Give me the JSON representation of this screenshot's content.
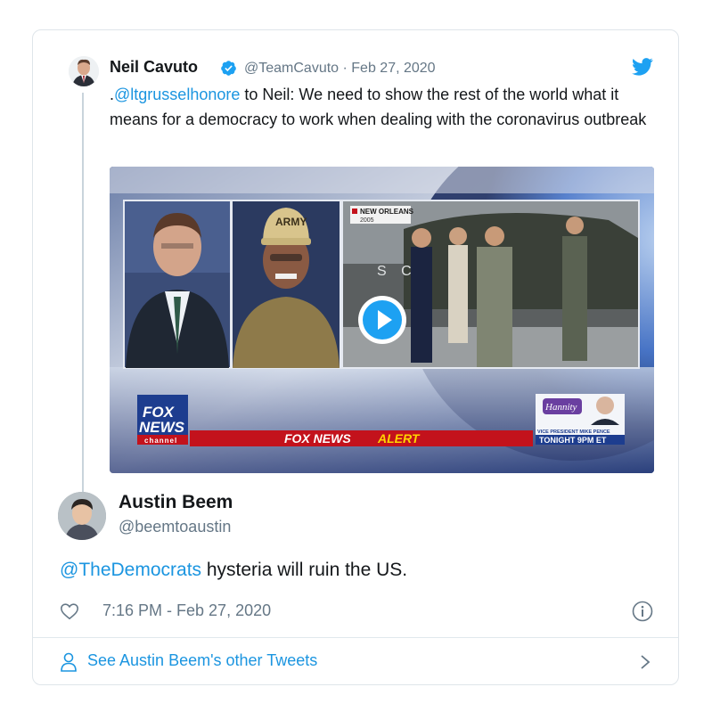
{
  "quoted_tweet": {
    "author_name": "Neil Cavuto",
    "meta": "@TeamCavuto · Feb 27, 2020",
    "text_prefix": ".",
    "mention": "@ltgrusselhonore",
    "text_rest": " to Neil: We need to show the rest of the world what it means for a democracy to work when dealing with the coronavirus outbreak",
    "media": {
      "locator_text": "NEW ORLEANS",
      "locator_year": "2005",
      "cap_text": "ARMY",
      "logo_line1": "FOX",
      "logo_line2": "NEWS",
      "logo_line3": "channel",
      "alert_prefix": "FOX NEWS",
      "alert_word": "ALERT",
      "promo_show": "Hannity",
      "promo_guest": "VICE PRESIDENT MIKE PENCE",
      "promo_time": "TONIGHT 9PM ET",
      "backdrop_letters": "S C"
    }
  },
  "tweet": {
    "author_name": "Austin Beem",
    "handle": "@beemtoaustin",
    "mention": "@TheDemocrats",
    "text_rest": " hysteria will ruin the US.",
    "timestamp": "7:16 PM - Feb 27, 2020"
  },
  "footer": {
    "link_text": "See Austin Beem's other Tweets"
  },
  "colors": {
    "link": "#1b95e0",
    "secondary_text": "#657786",
    "border": "#dfe5ea",
    "fox_red": "#c3121c",
    "alert_yellow": "#ffd400"
  },
  "icons": [
    "verified-badge-icon",
    "twitter-bird-icon",
    "play-icon",
    "heart-icon",
    "info-icon",
    "person-icon",
    "chevron-right-icon"
  ]
}
